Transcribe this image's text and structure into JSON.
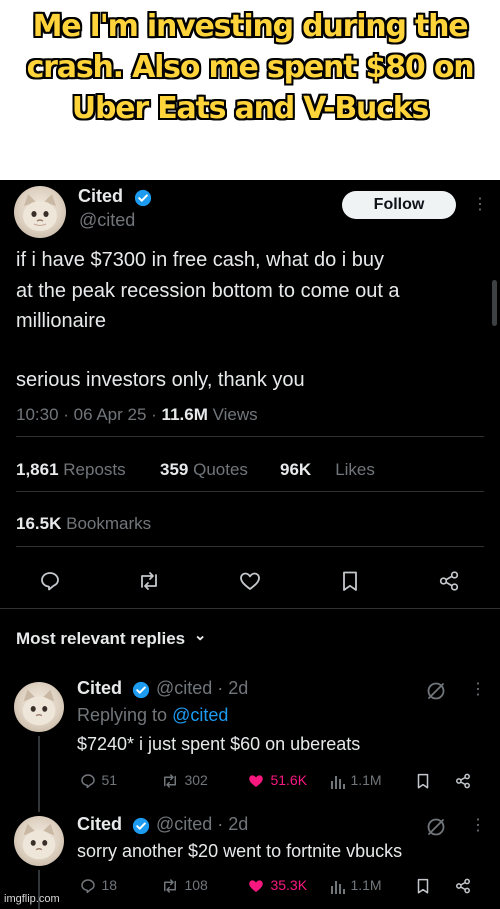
{
  "meme": {
    "caption": "Me I'm investing during the crash. Also me spent $80 on Uber Eats and V-Bucks",
    "colors": {
      "caption_fill": "#ffd33a",
      "caption_stroke": "#000000"
    }
  },
  "post": {
    "author": "Cited",
    "handle": "@cited",
    "follow_label": "Follow",
    "more_glyph": "⋮",
    "text_lines": [
      "if i have $7300 in free cash, what do i buy",
      "at the peak recession bottom to come out a",
      "millionaire",
      "serious investors only, thank you"
    ],
    "time": "10:30 · 06 Apr 25 · ",
    "views_count": "11.6M",
    "views_label": " Views",
    "stats": {
      "reposts_count": "1,861",
      "reposts_label": "Reposts",
      "quotes_count": "359",
      "quotes_label": "Quotes",
      "likes_count": "96K",
      "likes_label": "Likes",
      "bookmarks_count": "16.5K",
      "bookmarks_label": "Bookmarks"
    },
    "actions": [
      "reply-icon",
      "repost-icon",
      "like-icon",
      "bookmark-icon",
      "share-icon"
    ]
  },
  "replies_header": {
    "label": "Most relevant replies",
    "chevron": "⌄"
  },
  "replies": [
    {
      "author": "Cited",
      "handle_time": "@cited · 2d",
      "replying_prefix": "Replying to ",
      "replying_handle": "@cited",
      "text": "$7240* i just spent $60 on ubereats",
      "replies": "51",
      "reposts": "302",
      "likes": "51.6K",
      "views": "1.1M"
    },
    {
      "author": "Cited",
      "handle_time": "@cited · 2d",
      "text": "sorry another $20 went to fortnite vbucks",
      "replies": "18",
      "reposts": "108",
      "likes": "35.3K",
      "views": "1.1M"
    }
  ],
  "watermark": "imgflip.com",
  "colors": {
    "background": "#000000",
    "text": "#e7e9ea",
    "muted": "#71767b",
    "verified": "#1d9bf0",
    "like_active": "#f91880",
    "divider": "#2f3336"
  }
}
